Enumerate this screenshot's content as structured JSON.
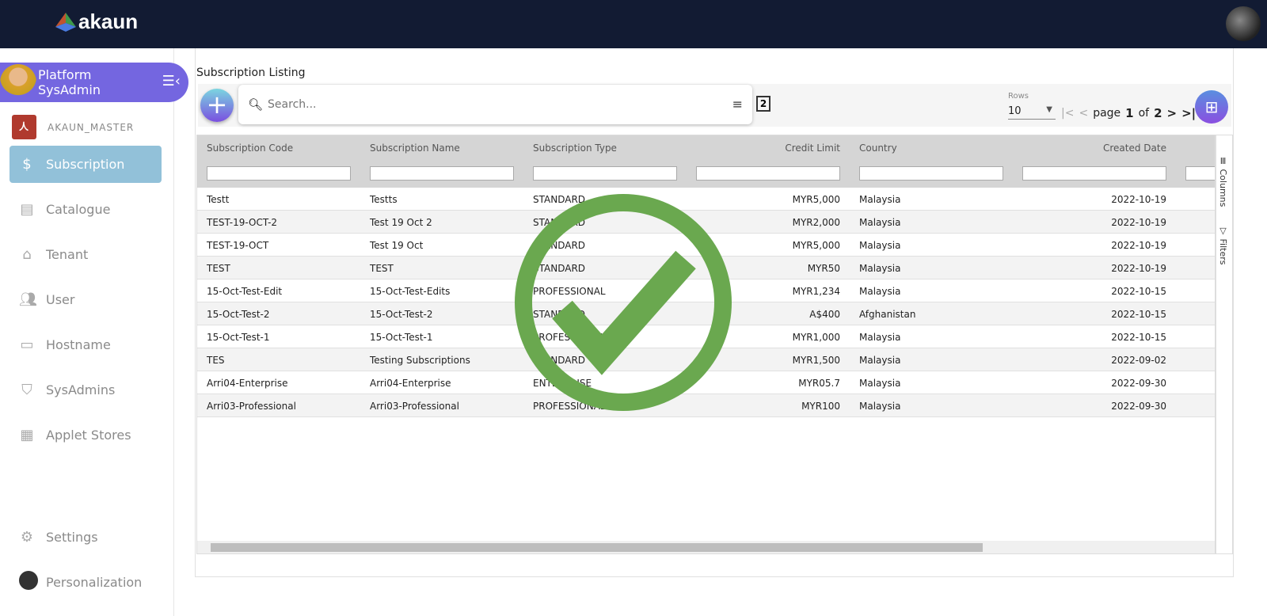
{
  "brand": {
    "name": "akaun"
  },
  "user": {
    "name": "Platform SysAdmin",
    "tenant": "AKAUN_MASTER"
  },
  "nav": [
    {
      "label": "Subscription",
      "icon": "dollar-icon",
      "active": true
    },
    {
      "label": "Catalogue",
      "icon": "list-icon"
    },
    {
      "label": "Tenant",
      "icon": "home-icon"
    },
    {
      "label": "User",
      "icon": "people-icon"
    },
    {
      "label": "Hostname",
      "icon": "server-icon"
    },
    {
      "label": "SysAdmins",
      "icon": "shield-icon"
    },
    {
      "label": "Applet Stores",
      "icon": "store-icon"
    }
  ],
  "bottom_nav": [
    {
      "label": "Settings",
      "icon": "gear-icon"
    },
    {
      "label": "Personalization",
      "icon": "avatar"
    }
  ],
  "page": {
    "title": "Subscription Listing"
  },
  "search": {
    "placeholder": "Search..."
  },
  "pager": {
    "rows_label": "Rows",
    "rows_value": "10",
    "page_word": "page",
    "page": "1",
    "of_word": "of",
    "total": "2"
  },
  "side_panel": {
    "columns": "Columns",
    "filters": "Filters"
  },
  "columns": [
    "Subscription Code",
    "Subscription Name",
    "Subscription Type",
    "Credit Limit",
    "Country",
    "Created Date"
  ],
  "rows": [
    [
      "Testt",
      "Testts",
      "STANDARD",
      "MYR5,000",
      "Malaysia",
      "2022-10-19"
    ],
    [
      "TEST-19-OCT-2",
      "Test 19 Oct 2",
      "STANDARD",
      "MYR2,000",
      "Malaysia",
      "2022-10-19"
    ],
    [
      "TEST-19-OCT",
      "Test 19 Oct",
      "STANDARD",
      "MYR5,000",
      "Malaysia",
      "2022-10-19"
    ],
    [
      "TEST",
      "TEST",
      "STANDARD",
      "MYR50",
      "Malaysia",
      "2022-10-19"
    ],
    [
      "15-Oct-Test-Edit",
      "15-Oct-Test-Edits",
      "PROFESSIONAL",
      "MYR1,234",
      "Malaysia",
      "2022-10-15"
    ],
    [
      "15-Oct-Test-2",
      "15-Oct-Test-2",
      "STANDARD",
      "A$400",
      "Afghanistan",
      "2022-10-15"
    ],
    [
      "15-Oct-Test-1",
      "15-Oct-Test-1",
      "PROFESSIONAL",
      "MYR1,000",
      "Malaysia",
      "2022-10-15"
    ],
    [
      "TES",
      "Testing Subscriptions",
      "STANDARD",
      "MYR1,500",
      "Malaysia",
      "2022-09-02"
    ],
    [
      "Arri04-Enterprise",
      "Arri04-Enterprise",
      "ENTERPRISE",
      "MYR05.7",
      "Malaysia",
      "2022-09-30"
    ],
    [
      "Arri03-Professional",
      "Arri03-Professional",
      "PROFESSIONAL",
      "MYR100",
      "Malaysia",
      "2022-09-30"
    ]
  ],
  "colors": {
    "topbar": "#121b33",
    "accent": "#7466e0",
    "active_nav": "#92c1d9",
    "check": "#6aa84f"
  }
}
